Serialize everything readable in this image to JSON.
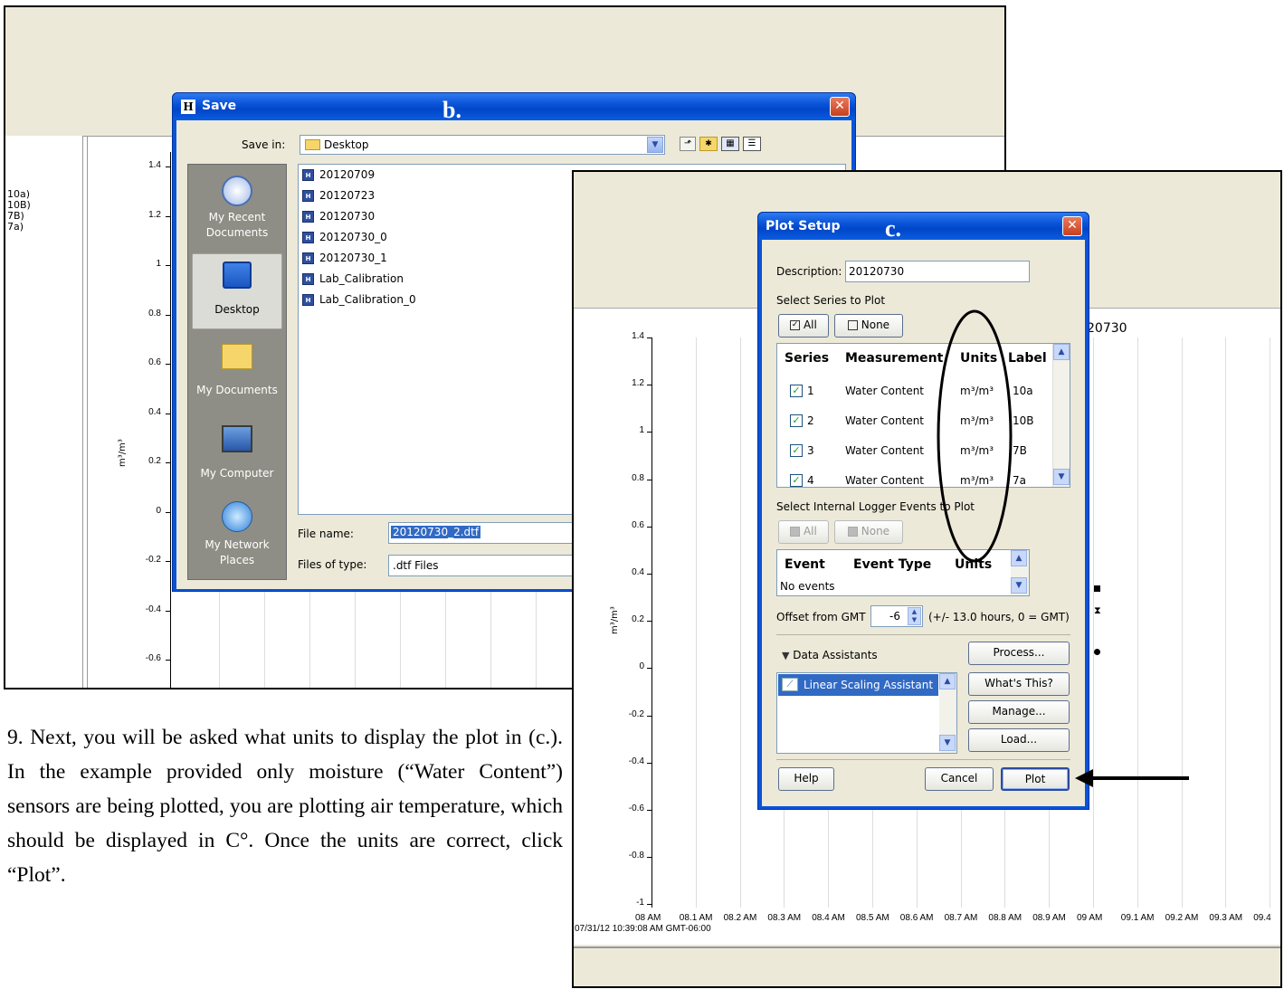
{
  "bg_app": {
    "legend": [
      "10a)",
      "10B)",
      "7B)",
      "7a)"
    ],
    "y_ticks": [
      "1.4",
      "1.2",
      "1",
      "0.8",
      "0.6",
      "0.4",
      "0.2",
      "0",
      "-0.2",
      "-0.4",
      "-0.6"
    ],
    "y_unit": "m³/m³"
  },
  "save_dialog": {
    "title": "Save",
    "annotation": "b.",
    "save_in_label": "Save in:",
    "save_in_value": "Desktop",
    "places": [
      {
        "label": "My Recent Documents",
        "icon": "recent-documents-icon"
      },
      {
        "label": "Desktop",
        "icon": "desktop-icon"
      },
      {
        "label": "My Documents",
        "icon": "my-documents-icon"
      },
      {
        "label": "My Computer",
        "icon": "my-computer-icon"
      },
      {
        "label": "My Network Places",
        "icon": "network-places-icon"
      }
    ],
    "files": [
      "20120709",
      "20120723",
      "20120730",
      "20120730_0",
      "20120730_1",
      "Lab_Calibration",
      "Lab_Calibration_0"
    ],
    "file_name_label": "File name:",
    "file_name_value": "20120730_2.dtf",
    "files_of_type_label": "Files of type:",
    "files_of_type_value": ".dtf Files"
  },
  "instructions": {
    "text": "9. Next, you will be asked what units to display the plot in (c.). In the example provided only moisture (“Water Content”) sensors are being plotted, you are plotting air temperature, which should be displayed in C°. Once the units are correct, click “Plot”."
  },
  "plot_window": {
    "partial_title": "20730",
    "y_ticks": [
      "1.4",
      "1.2",
      "1",
      "0.8",
      "0.6",
      "0.4",
      "0.2",
      "0",
      "-0.2",
      "-0.4",
      "-0.6",
      "-0.8",
      "-1"
    ],
    "y_unit": "m³/m³",
    "x_ticks": [
      "08 AM",
      "08.1 AM",
      "08.2 AM",
      "08.3 AM",
      "08.4 AM",
      "08.5 AM",
      "08.6 AM",
      "08.7 AM",
      "08.8 AM",
      "08.9 AM",
      "09 AM",
      "09.1 AM",
      "09.2 AM",
      "09.3 AM",
      "09.4"
    ],
    "timestamp": "07/31/12 10:39:08 AM GMT-06:00"
  },
  "plot_setup": {
    "title": "Plot Setup",
    "annotation": "c.",
    "description_label": "Description:",
    "description_value": "20120730",
    "select_series_label": "Select Series to Plot",
    "all_label": "All",
    "none_label": "None",
    "columns": [
      "Series",
      "Measurement",
      "Units",
      "Label"
    ],
    "rows": [
      {
        "series": "1",
        "measurement": "Water Content",
        "units": "m³/m³",
        "label": "10a"
      },
      {
        "series": "2",
        "measurement": "Water Content",
        "units": "m³/m³",
        "label": "10B"
      },
      {
        "series": "3",
        "measurement": "Water Content",
        "units": "m³/m³",
        "label": "7B"
      },
      {
        "series": "4",
        "measurement": "Water Content",
        "units": "m³/m³",
        "label": "7a"
      }
    ],
    "events_label": "Select Internal Logger Events to Plot",
    "event_columns": [
      "Event",
      "Event Type",
      "Units"
    ],
    "no_events": "No events",
    "offset_label": "Offset from GMT",
    "offset_value": "-6",
    "offset_hint": "(+/- 13.0 hours, 0 = GMT)",
    "data_assistants_label": "Data Assistants",
    "assistant_item": "Linear Scaling Assistant",
    "process_label": "Process...",
    "whats_this_label": "What's This?",
    "manage_label": "Manage...",
    "load_label": "Load...",
    "help_label": "Help",
    "cancel_label": "Cancel",
    "plot_label": "Plot"
  }
}
